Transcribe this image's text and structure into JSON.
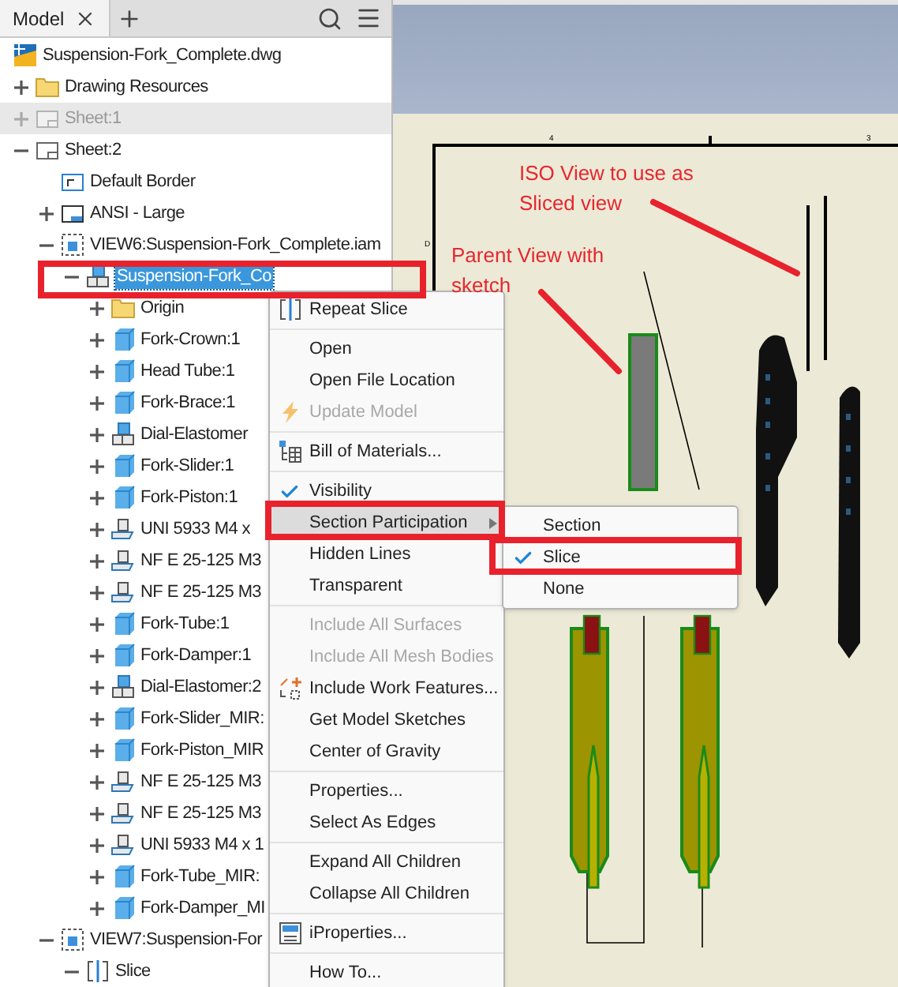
{
  "panel": {
    "tab": "Model"
  },
  "tree": [
    {
      "label": "Suspension-Fork_Complete.dwg",
      "kind": "file",
      "selected": false,
      "disabled": false,
      "children": [
        {
          "label": "Drawing Resources",
          "kind": "folder",
          "expanded": false,
          "selected": false,
          "disabled": false
        },
        {
          "label": "Sheet:1",
          "kind": "sheet",
          "expanded": false,
          "selected": false,
          "disabled": true
        },
        {
          "label": "Sheet:2",
          "kind": "sheet",
          "expanded": true,
          "selected": false,
          "disabled": false,
          "children": [
            {
              "label": "Default Border",
              "kind": "border",
              "selected": false,
              "disabled": false
            },
            {
              "label": "ANSI - Large",
              "kind": "titleblock",
              "expanded": false,
              "selected": false,
              "disabled": false
            },
            {
              "label": "VIEW6:Suspension-Fork_Complete.iam",
              "kind": "view",
              "expanded": true,
              "selected": false,
              "disabled": false,
              "children": [
                {
                  "label": "Suspension-Fork_Co",
                  "kind": "assembly",
                  "expanded": true,
                  "selected": true,
                  "disabled": false,
                  "children": [
                    {
                      "label": "Origin",
                      "kind": "folder",
                      "expanded": false,
                      "selected": false,
                      "disabled": false
                    },
                    {
                      "label": "Fork-Crown:1",
                      "kind": "part",
                      "expanded": false,
                      "selected": false,
                      "disabled": false
                    },
                    {
                      "label": "Head Tube:1",
                      "kind": "part",
                      "expanded": false,
                      "selected": false,
                      "disabled": false
                    },
                    {
                      "label": "Fork-Brace:1",
                      "kind": "part",
                      "expanded": false,
                      "selected": false,
                      "disabled": false
                    },
                    {
                      "label": "Dial-Elastomer",
                      "kind": "assembly",
                      "expanded": false,
                      "selected": false,
                      "disabled": false
                    },
                    {
                      "label": "Fork-Slider:1",
                      "kind": "part",
                      "expanded": false,
                      "selected": false,
                      "disabled": false
                    },
                    {
                      "label": "Fork-Piston:1",
                      "kind": "part",
                      "expanded": false,
                      "selected": false,
                      "disabled": false
                    },
                    {
                      "label": "UNI 5933 M4 x",
                      "kind": "fastener",
                      "expanded": false,
                      "selected": false,
                      "disabled": false
                    },
                    {
                      "label": "NF E 25-125 M3",
                      "kind": "fastener",
                      "expanded": false,
                      "selected": false,
                      "disabled": false
                    },
                    {
                      "label": "NF E 25-125 M3",
                      "kind": "fastener",
                      "expanded": false,
                      "selected": false,
                      "disabled": false
                    },
                    {
                      "label": "Fork-Tube:1",
                      "kind": "part",
                      "expanded": false,
                      "selected": false,
                      "disabled": false
                    },
                    {
                      "label": "Fork-Damper:1",
                      "kind": "part",
                      "expanded": false,
                      "selected": false,
                      "disabled": false
                    },
                    {
                      "label": "Dial-Elastomer:2",
                      "kind": "assembly",
                      "expanded": false,
                      "selected": false,
                      "disabled": false
                    },
                    {
                      "label": "Fork-Slider_MIR:",
                      "kind": "part",
                      "expanded": false,
                      "selected": false,
                      "disabled": false
                    },
                    {
                      "label": "Fork-Piston_MIR",
                      "kind": "part",
                      "expanded": false,
                      "selected": false,
                      "disabled": false
                    },
                    {
                      "label": "NF E 25-125 M3",
                      "kind": "fastener",
                      "expanded": false,
                      "selected": false,
                      "disabled": false
                    },
                    {
                      "label": "NF E 25-125 M3",
                      "kind": "fastener",
                      "expanded": false,
                      "selected": false,
                      "disabled": false
                    },
                    {
                      "label": "UNI 5933 M4 x 1",
                      "kind": "fastener",
                      "expanded": false,
                      "selected": false,
                      "disabled": false
                    },
                    {
                      "label": "Fork-Tube_MIR:",
                      "kind": "part",
                      "expanded": false,
                      "selected": false,
                      "disabled": false
                    },
                    {
                      "label": "Fork-Damper_MI",
                      "kind": "part",
                      "expanded": false,
                      "selected": false,
                      "disabled": false
                    }
                  ]
                }
              ]
            },
            {
              "label": "VIEW7:Suspension-For",
              "kind": "view",
              "expanded": true,
              "selected": false,
              "disabled": false,
              "children": [
                {
                  "label": "Slice",
                  "kind": "slice",
                  "expanded": true,
                  "selected": false,
                  "disabled": false
                }
              ]
            }
          ]
        }
      ]
    }
  ],
  "context_menu": [
    {
      "kind": "slice",
      "label": "Repeat Slice",
      "disabled": false,
      "checked": false,
      "selected": false
    },
    {
      "kind": "separator"
    },
    {
      "kind": "plain",
      "label": "Open",
      "disabled": false,
      "checked": false,
      "selected": false
    },
    {
      "kind": "plain",
      "label": "Open File Location",
      "disabled": false,
      "checked": false,
      "selected": false
    },
    {
      "kind": "bolt",
      "label": "Update Model",
      "disabled": true,
      "checked": false,
      "selected": false
    },
    {
      "kind": "separator"
    },
    {
      "kind": "table",
      "label": "Bill of Materials...",
      "disabled": false,
      "checked": false,
      "selected": false
    },
    {
      "kind": "separator"
    },
    {
      "kind": "plain",
      "label": "Visibility",
      "disabled": false,
      "checked": true,
      "selected": false
    },
    {
      "kind": "plain",
      "label": "Section Participation",
      "disabled": false,
      "checked": false,
      "selected": true,
      "submenu": true
    },
    {
      "kind": "plain",
      "label": "Hidden Lines",
      "disabled": false,
      "checked": false,
      "selected": false
    },
    {
      "kind": "plain",
      "label": "Transparent",
      "disabled": false,
      "checked": false,
      "selected": false
    },
    {
      "kind": "separator"
    },
    {
      "kind": "plain",
      "label": "Include All Surfaces",
      "disabled": true,
      "checked": false,
      "selected": false
    },
    {
      "kind": "plain",
      "label": "Include All Mesh Bodies",
      "disabled": true,
      "checked": false,
      "selected": false
    },
    {
      "kind": "features",
      "label": "Include Work Features...",
      "disabled": false,
      "checked": false,
      "selected": false
    },
    {
      "kind": "plain",
      "label": "Get Model Sketches",
      "disabled": false,
      "checked": false,
      "selected": false
    },
    {
      "kind": "plain",
      "label": "Center of Gravity",
      "disabled": false,
      "checked": false,
      "selected": false
    },
    {
      "kind": "separator"
    },
    {
      "kind": "plain",
      "label": "Properties...",
      "disabled": false,
      "checked": false,
      "selected": false
    },
    {
      "kind": "plain",
      "label": "Select As Edges",
      "disabled": false,
      "checked": false,
      "selected": false
    },
    {
      "kind": "separator"
    },
    {
      "kind": "plain",
      "label": "Expand All Children",
      "disabled": false,
      "checked": false,
      "selected": false
    },
    {
      "kind": "plain",
      "label": "Collapse All Children",
      "disabled": false,
      "checked": false,
      "selected": false
    },
    {
      "kind": "separator"
    },
    {
      "kind": "properties",
      "label": "iProperties...",
      "disabled": false,
      "checked": false,
      "selected": false
    },
    {
      "kind": "separator"
    },
    {
      "kind": "plain",
      "label": "How To...",
      "disabled": false,
      "checked": false,
      "selected": false
    }
  ],
  "submenu": [
    {
      "label": "Section",
      "checked": false
    },
    {
      "label": "Slice",
      "checked": true
    },
    {
      "label": "None",
      "checked": false
    }
  ],
  "sheet": {
    "zone_labels": [
      "4",
      "3",
      "D"
    ]
  },
  "annotations": [
    {
      "text": "ISO View to use as Sliced view"
    },
    {
      "text": "Parent View with sketch"
    }
  ]
}
